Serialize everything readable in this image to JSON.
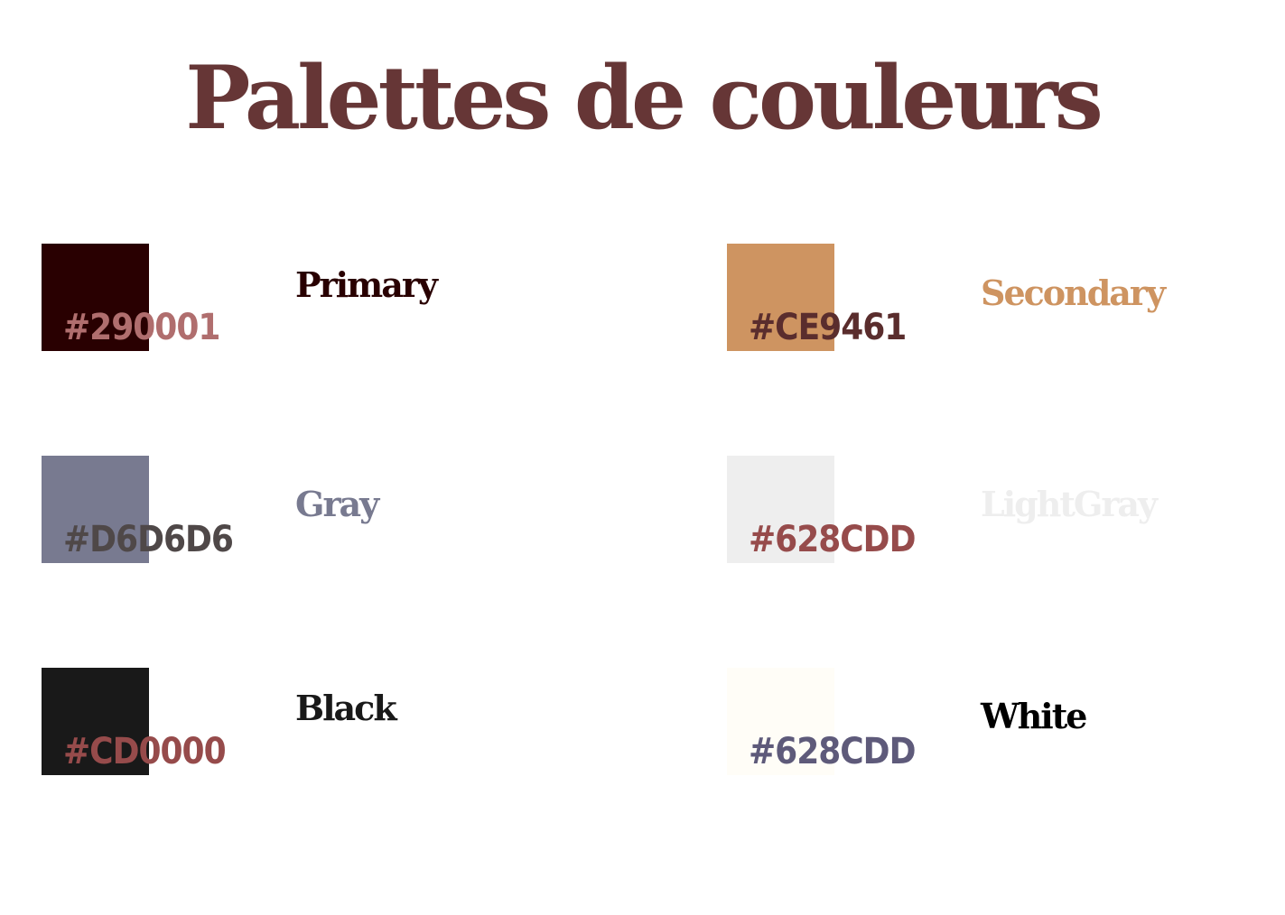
{
  "title": "Palettes de couleurs",
  "colors": {
    "title": "#663636"
  },
  "swatches": [
    {
      "name": "Primary",
      "hex_label": "#290001",
      "swatch_color": "#290001",
      "hex_text_color": "#B06E6E",
      "name_color": "#290001"
    },
    {
      "name": "Secondary",
      "hex_label": "#CE9461",
      "swatch_color": "#CE9461",
      "hex_text_color": "#5A2D2D",
      "name_color": "#CE9461"
    },
    {
      "name": "Gray",
      "hex_label": "#D6D6D6",
      "swatch_color": "#787A90",
      "hex_text_color": "#4F4848",
      "name_color": "#787A90"
    },
    {
      "name": "LightGray",
      "hex_label": "#628CDD",
      "swatch_color": "#EEEEEE",
      "hex_text_color": "#964B4B",
      "name_color": "#EEEEEE"
    },
    {
      "name": "Black",
      "hex_label": "#CD0000",
      "swatch_color": "#191919",
      "hex_text_color": "#964B4B",
      "name_color": "#191919"
    },
    {
      "name": "White",
      "hex_label": "#628CDD",
      "swatch_color": "#FFFDF7",
      "hex_text_color": "#5E5A7A",
      "name_color": "#000000"
    }
  ]
}
